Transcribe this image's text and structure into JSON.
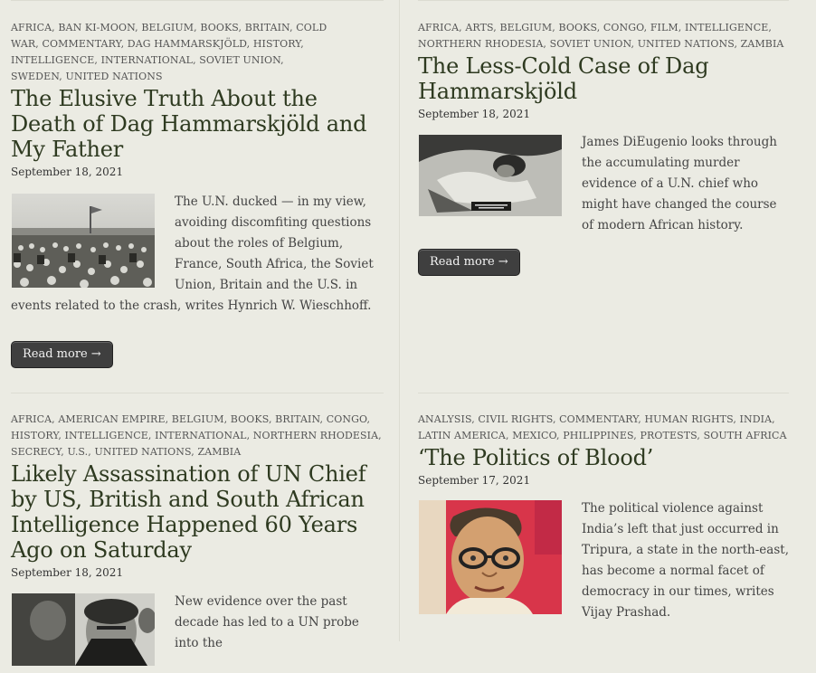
{
  "posts": [
    {
      "tags": [
        "Africa",
        "Ban Ki-moon",
        "Belgium",
        "Books",
        "Britain",
        "Cold War",
        "Commentary",
        "Dag Hammarskjöld",
        "History",
        "Intelligence",
        "International",
        "Soviet Union",
        "Sweden",
        "United Nations"
      ],
      "title": "The Elusive Truth About the Death of Dag Hammarskjöld and My Father",
      "date": "September 18, 2021",
      "excerpt": "The U.N. ducked — in my view, avoiding discomfiting questions about the roles of Belgium, France, South Africa, the Soviet Union, Britain and the U.S. in events related to the crash, writes Hynrich W. Wieschhoff.",
      "read_more": "Read more",
      "arrow": "→"
    },
    {
      "tags": [
        "Africa",
        "Arts",
        "Belgium",
        "Books",
        "Congo",
        "Film",
        "Intelligence",
        "Northern Rhodesia",
        "Soviet Union",
        "United Nations",
        "Zambia"
      ],
      "title": "The Less-Cold Case of Dag Hammarskjöld",
      "date": "September 18, 2021",
      "excerpt": "James DiEugenio looks through the accumulating murder evidence of a U.N. chief who might have changed the course of modern African history.",
      "read_more": "Read more",
      "arrow": "→"
    },
    {
      "tags": [
        "Africa",
        "American Empire",
        "Belgium",
        "Books",
        "Britain",
        "Congo",
        "History",
        "Intelligence",
        "International",
        "Northern Rhodesia",
        "Secrecy",
        "U.S.",
        "United Nations",
        "Zambia"
      ],
      "title": "Likely Assassination of UN Chief by US, British and South African Intelligence Happened 60 Years Ago on Saturday",
      "date": "September 18, 2021",
      "excerpt": "New evidence over the past decade has led to a UN probe into the"
    },
    {
      "tags": [
        "Analysis",
        "Civil Rights",
        "Commentary",
        "Human Rights",
        "India",
        "Latin America",
        "Mexico",
        "Philippines",
        "Protests",
        "South Africa"
      ],
      "title": "‘The Politics of Blood’",
      "date": "September 17, 2021",
      "excerpt": "The political violence against India’s left that just occurred in Tripura, a state in the north-east, has become a normal facet of democracy in our times, writes Vijay Prashad."
    }
  ]
}
